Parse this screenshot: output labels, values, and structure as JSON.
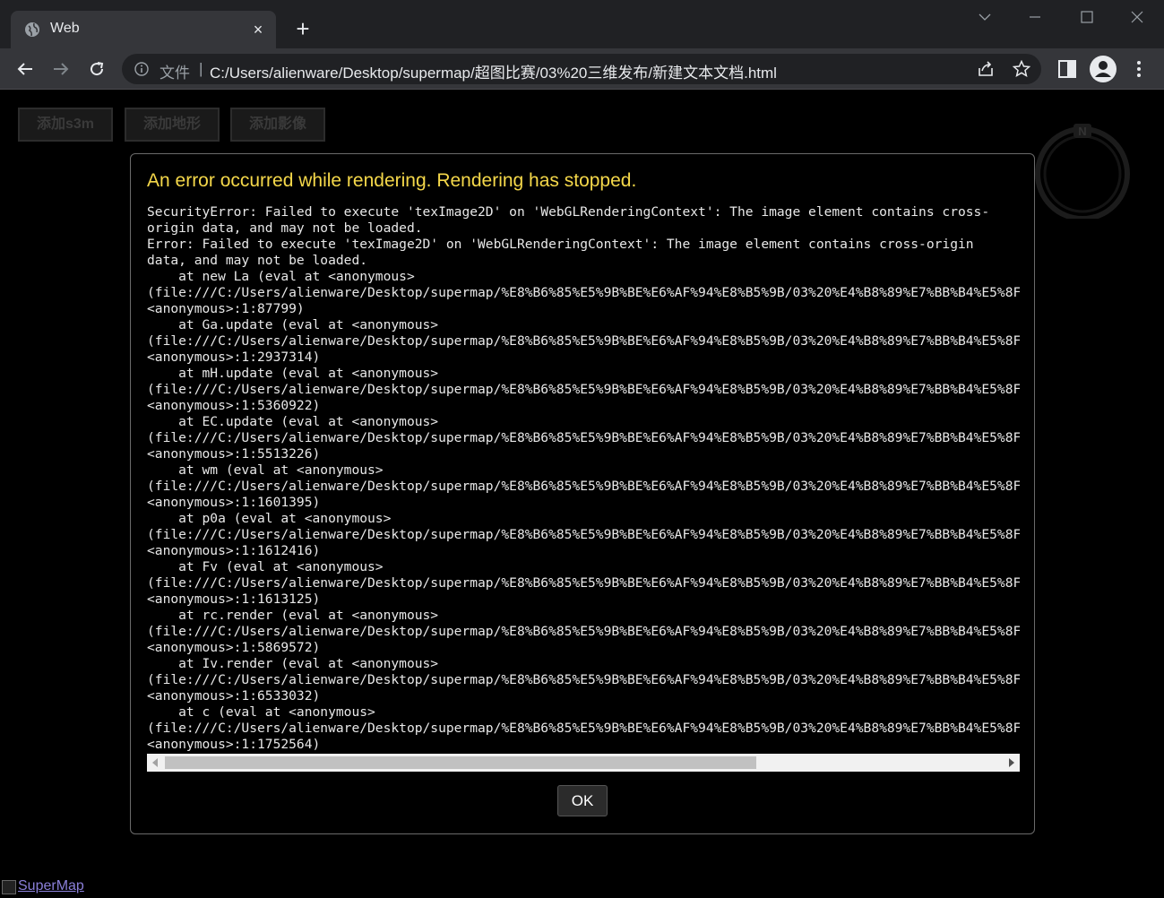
{
  "browser": {
    "tab_title": "Web",
    "tab_close": "×",
    "new_tab": "+",
    "address_scheme_label": "文件",
    "address_separator": "|",
    "url": "C:/Users/alienware/Desktop/supermap/超图比赛/03%20三维发布/新建文本文档.html"
  },
  "toolbar": {
    "buttons": [
      "添加s3m",
      "添加地形",
      "添加影像"
    ]
  },
  "dialog": {
    "title": "An error occurred while rendering. Rendering has stopped.",
    "stack_lines": [
      "SecurityError: Failed to execute 'texImage2D' on 'WebGLRenderingContext': The image element contains cross-",
      "origin data, and may not be loaded.",
      "Error: Failed to execute 'texImage2D' on 'WebGLRenderingContext': The image element contains cross-origin",
      "data, and may not be loaded.",
      "    at new La (eval at <anonymous>",
      "(file:///C:/Users/alienware/Desktop/supermap/%E8%B6%85%E5%9B%BE%E6%AF%94%E8%B5%9B/03%20%E4%B8%89%E7%BB%B4%E5%8F",
      "<anonymous>:1:87799)",
      "    at Ga.update (eval at <anonymous>",
      "(file:///C:/Users/alienware/Desktop/supermap/%E8%B6%85%E5%9B%BE%E6%AF%94%E8%B5%9B/03%20%E4%B8%89%E7%BB%B4%E5%8F",
      "<anonymous>:1:2937314)",
      "    at mH.update (eval at <anonymous>",
      "(file:///C:/Users/alienware/Desktop/supermap/%E8%B6%85%E5%9B%BE%E6%AF%94%E8%B5%9B/03%20%E4%B8%89%E7%BB%B4%E5%8F",
      "<anonymous>:1:5360922)",
      "    at EC.update (eval at <anonymous>",
      "(file:///C:/Users/alienware/Desktop/supermap/%E8%B6%85%E5%9B%BE%E6%AF%94%E8%B5%9B/03%20%E4%B8%89%E7%BB%B4%E5%8F",
      "<anonymous>:1:5513226)",
      "    at wm (eval at <anonymous>",
      "(file:///C:/Users/alienware/Desktop/supermap/%E8%B6%85%E5%9B%BE%E6%AF%94%E8%B5%9B/03%20%E4%B8%89%E7%BB%B4%E5%8F",
      "<anonymous>:1:1601395)",
      "    at p0a (eval at <anonymous>",
      "(file:///C:/Users/alienware/Desktop/supermap/%E8%B6%85%E5%9B%BE%E6%AF%94%E8%B5%9B/03%20%E4%B8%89%E7%BB%B4%E5%8F",
      "<anonymous>:1:1612416)",
      "    at Fv (eval at <anonymous>",
      "(file:///C:/Users/alienware/Desktop/supermap/%E8%B6%85%E5%9B%BE%E6%AF%94%E8%B5%9B/03%20%E4%B8%89%E7%BB%B4%E5%8F",
      "<anonymous>:1:1613125)",
      "    at rc.render (eval at <anonymous>",
      "(file:///C:/Users/alienware/Desktop/supermap/%E8%B6%85%E5%9B%BE%E6%AF%94%E8%B5%9B/03%20%E4%B8%89%E7%BB%B4%E5%8F",
      "<anonymous>:1:5869572)",
      "    at Iv.render (eval at <anonymous>",
      "(file:///C:/Users/alienware/Desktop/supermap/%E8%B6%85%E5%9B%BE%E6%AF%94%E8%B5%9B/03%20%E4%B8%89%E7%BB%B4%E5%8F",
      "<anonymous>:1:6533032)",
      "    at c (eval at <anonymous>",
      "(file:///C:/Users/alienware/Desktop/supermap/%E8%B6%85%E5%9B%BE%E6%AF%94%E8%B5%9B/03%20%E4%B8%89%E7%BB%B4%E5%8F",
      "<anonymous>:1:1752564)"
    ],
    "ok_label": "OK"
  },
  "compass": {
    "north_label": "N"
  },
  "footer": {
    "logo_text": "SuperMap"
  },
  "colors": {
    "title_yellow": "#f5d84a",
    "browser_chrome": "#35363a",
    "link_purple": "#8a7fd8"
  }
}
